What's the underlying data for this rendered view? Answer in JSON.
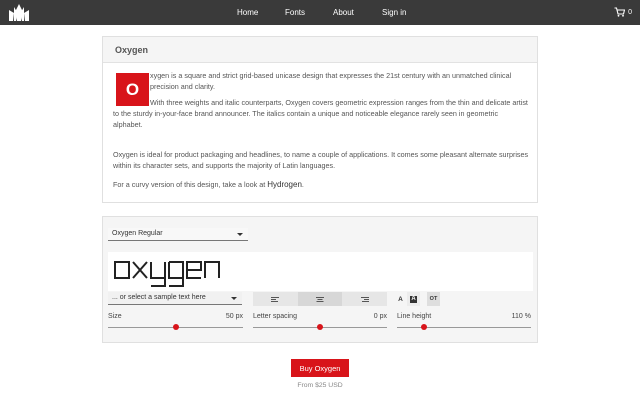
{
  "nav": {
    "home": "Home",
    "fonts": "Fonts",
    "about": "About",
    "signin": "Sign in",
    "cart_count": "0"
  },
  "about": {
    "title": "Oxygen",
    "dropcap": "O",
    "p1": "xygen is a square and strict grid-based unicase design that expresses the 21st century with an unmatched clinical precision and clarity.",
    "p2": "With three weights and italic counterparts, Oxygen covers geometric expression ranges from the thin and delicate artist to the sturdy in-your-face brand announcer. The italics contain a unique and noticeable elegance rarely seen in geometric alphabet.",
    "p3": "Oxygen is ideal for product packaging and headlines, to name a couple of applications. It comes some pleasant alternate surprises within its character sets, and supports the majority of Latin languages.",
    "p4_prefix": "For a curvy version of this design, take a look at ",
    "p4_link": "Hydrogen",
    "p4_suffix": "."
  },
  "tester": {
    "font_select": "Oxygen Regular",
    "preview_text": "oxygen",
    "sample_select": "... or select a sample text here",
    "align_active": "center",
    "format_buttons": [
      "A",
      "A",
      "OT"
    ],
    "size_label": "Size",
    "size_value": "50 px",
    "size_fraction": 0.5,
    "spacing_label": "Letter spacing",
    "spacing_value": "0 px",
    "spacing_fraction": 0.5,
    "lineheight_label": "Line height",
    "lineheight_value": "110 %",
    "lineheight_fraction": 0.2
  },
  "purchase": {
    "button": "Buy Oxygen",
    "price": "From $25 USD"
  },
  "colors": {
    "accent": "#d8141a",
    "nav_bg": "#3a3a3a"
  }
}
